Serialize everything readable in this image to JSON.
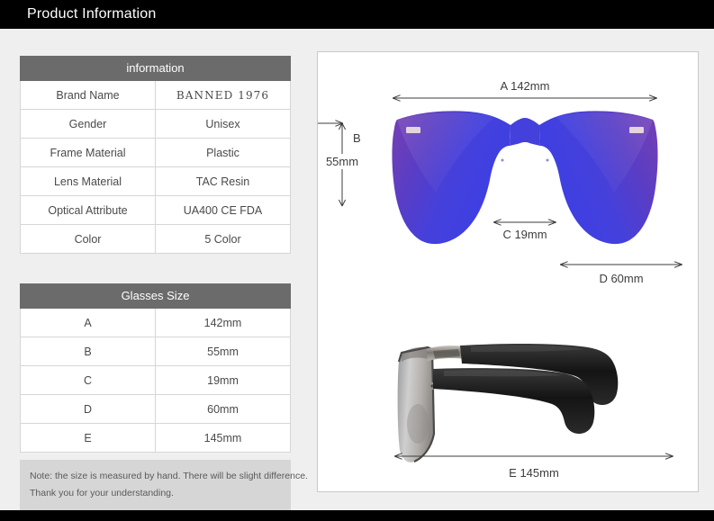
{
  "header": {
    "title": "Product Information"
  },
  "information_table": {
    "header": "information",
    "rows": [
      {
        "key": "Brand Name",
        "value": "BANNED 1976"
      },
      {
        "key": "Gender",
        "value": "Unisex"
      },
      {
        "key": "Frame Material",
        "value": "Plastic"
      },
      {
        "key": "Lens Material",
        "value": "TAC Resin"
      },
      {
        "key": "Optical Attribute",
        "value": "UA400 CE FDA"
      },
      {
        "key": "Color",
        "value": "5 Color"
      }
    ]
  },
  "glasses_size_table": {
    "header": "Glasses Size",
    "rows": [
      {
        "key": "A",
        "value": "142mm"
      },
      {
        "key": "B",
        "value": "55mm"
      },
      {
        "key": "C",
        "value": "19mm"
      },
      {
        "key": "D",
        "value": "60mm"
      },
      {
        "key": "E",
        "value": "145mm"
      }
    ]
  },
  "note": {
    "line1": "Note: the size is measured by hand. There will be slight difference.",
    "line2": "Thank you for your understanding."
  },
  "diagram": {
    "dimensions": {
      "a_label": "A 142mm",
      "b_letter": "B",
      "b_value": "55mm",
      "c_label": "C 19mm",
      "d_label": "D 60mm",
      "e_label": "E 145mm"
    }
  },
  "colors": {
    "title_bar": "#000000",
    "page_background": "#efefef",
    "table_header": "#6b6b6b",
    "table_border": "#d6d6d6",
    "note_background": "#d6d6d6",
    "text": "#4a4a4a",
    "lens_purple": "#6a3fb5",
    "lens_blue": "#3b3ee0",
    "temple_black": "#1c1c1c",
    "dim_line": "#3d3d3d"
  }
}
